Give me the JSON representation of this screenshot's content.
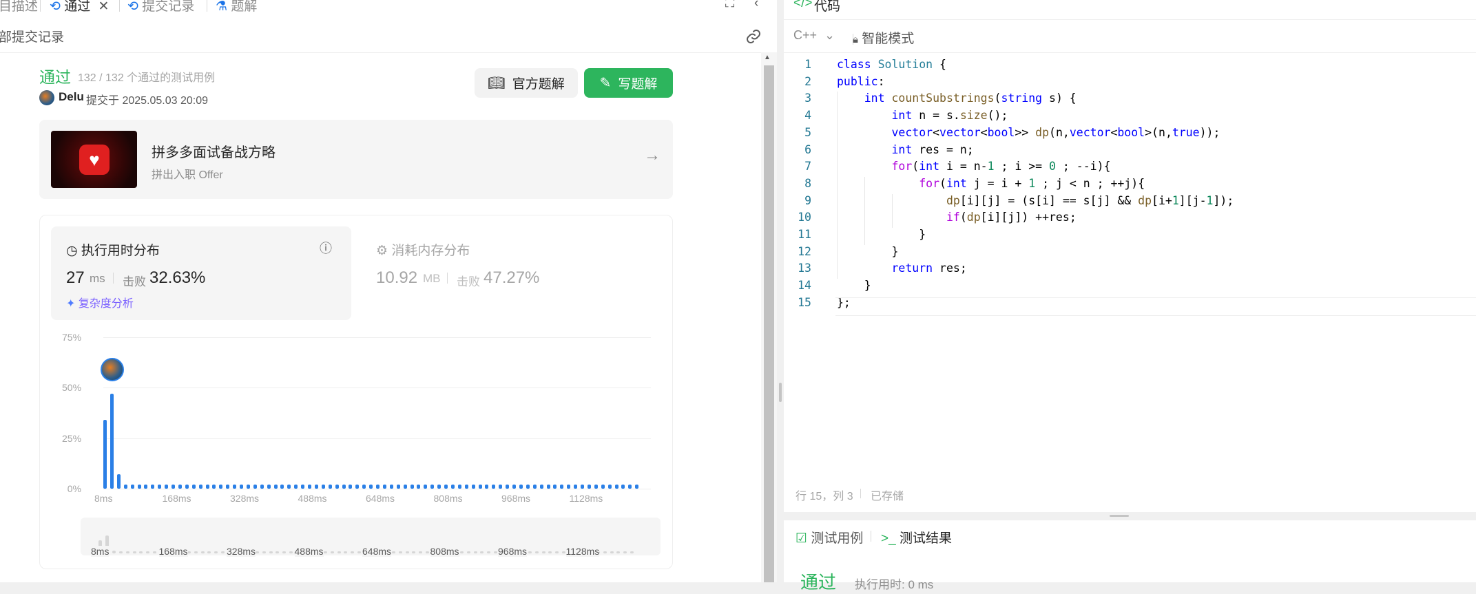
{
  "tabs": [
    {
      "label": "目描述",
      "active": false
    },
    {
      "label": "通过",
      "active": true
    },
    {
      "label": "提交记录",
      "active": false
    },
    {
      "label": "题解",
      "active": false
    }
  ],
  "subbar": {
    "title": "部提交记录"
  },
  "result": {
    "status": "通过",
    "cases": "132 / 132 个通过的测试用例",
    "user": "Delu",
    "submitted": "提交于 2025.05.03 20:09",
    "official_btn": "官方题解",
    "write_btn": "写题解"
  },
  "ad": {
    "title": "拼多多面试备战方略",
    "subtitle": "拼出入职 Offer"
  },
  "stats": {
    "time_title": "执行用时分布",
    "time_value": "27",
    "time_unit": "ms",
    "beat_label": "击败",
    "time_beat": "32.63%",
    "complexity": "复杂度分析",
    "mem_title": "消耗内存分布",
    "mem_value": "10.92",
    "mem_unit": "MB",
    "mem_beat": "47.27%"
  },
  "chart_data": {
    "type": "bar",
    "y_ticks": [
      "75%",
      "50%",
      "25%",
      "0%"
    ],
    "ylim": [
      0,
      75
    ],
    "x_ticks": [
      "8ms",
      "168ms",
      "328ms",
      "488ms",
      "648ms",
      "808ms",
      "968ms",
      "1128ms"
    ],
    "values": [
      34,
      47,
      7,
      2,
      2,
      2,
      2,
      2,
      2,
      2,
      2,
      2,
      2,
      2,
      2,
      2,
      2,
      2,
      2,
      2,
      2,
      2,
      2,
      2,
      2,
      2,
      2,
      2,
      2,
      2,
      2,
      2,
      2,
      2,
      2,
      2,
      2,
      2,
      2,
      2,
      2,
      2,
      2,
      2,
      2,
      2,
      2,
      2,
      2,
      2,
      2,
      2,
      2,
      2,
      2,
      2,
      2,
      2,
      2,
      2,
      2,
      2,
      2,
      2,
      2,
      2,
      2,
      2,
      2,
      2,
      2,
      2,
      2,
      2,
      2,
      2,
      2,
      2,
      2
    ],
    "highlight_index": 1,
    "color": "#2a7fe6"
  },
  "editor": {
    "header": "代码",
    "language": "C++",
    "mode": "智能模式",
    "status_pos": "行 15，列 3",
    "status_saved": "已存储",
    "lines": [
      "class Solution {",
      "public:",
      "    int countSubstrings(string s) {",
      "        int n = s.size();",
      "        vector<vector<bool>> dp(n,vector<bool>(n,true));",
      "        int res = n;",
      "        for(int i = n-1 ; i >= 0 ; --i){",
      "            for(int j = i + 1 ; j < n ; ++j){",
      "                dp[i][j] = (s[i] == s[j] && dp[i+1][j-1]);",
      "                if(dp[i][j]) ++res;",
      "            }",
      "        }",
      "        return res;",
      "    }",
      "};"
    ]
  },
  "bottom": {
    "tab_cases": "测试用例",
    "tab_result": "测试结果",
    "pass": "通过",
    "time_partial": "执行用时: 0 ms"
  }
}
